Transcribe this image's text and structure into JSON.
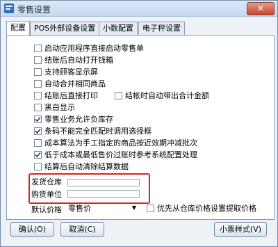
{
  "window": {
    "title": "零售设置",
    "close_glyph": "✕"
  },
  "tabs": [
    {
      "label": "配置",
      "active": true
    },
    {
      "label": "POS外部设备设置",
      "active": false
    },
    {
      "label": "小数配置",
      "active": false
    },
    {
      "label": "电子秤设置",
      "active": false
    }
  ],
  "options": [
    {
      "label": "启动应用程序直接启动零售单",
      "checked": false
    },
    {
      "label": "结账后自动打开钱箱",
      "checked": false
    },
    {
      "label": "支持顾客显示屏",
      "checked": false
    },
    {
      "label": "自动合并相同商品",
      "checked": false
    },
    {
      "label": "结账后直接打印",
      "checked": false
    },
    {
      "label": "结帐时自动带出合计金额",
      "checked": false
    },
    {
      "label": "黑白显示",
      "checked": false
    },
    {
      "label": "零售业务允许负库存",
      "checked": true
    },
    {
      "label": "条码不能完全匹配时调用选择框",
      "checked": true
    },
    {
      "label": "成本算法为手工指定的商品按近效期冲减批次",
      "checked": false
    },
    {
      "label": "低于成本或最低售价过账时参考系统配置处理",
      "checked": true
    },
    {
      "label": "结算后自动清除结算数据",
      "checked": false
    }
  ],
  "fields": {
    "warehouse_label": "发货仓库",
    "warehouse_value": "",
    "buyer_label": "购货单位",
    "buyer_value": ""
  },
  "price": {
    "label": "默认价格",
    "selected": "零售价",
    "priority_label": "优先从仓库价格设置提取价格",
    "priority_checked": false
  },
  "buttons": {
    "ok": "确认(O)",
    "cancel": "取消(C)",
    "receipt_style": "小票样式(V)"
  },
  "colors": {
    "accent": "#3a6ea5",
    "highlight_box": "#e02020",
    "close": "#c7442d"
  }
}
